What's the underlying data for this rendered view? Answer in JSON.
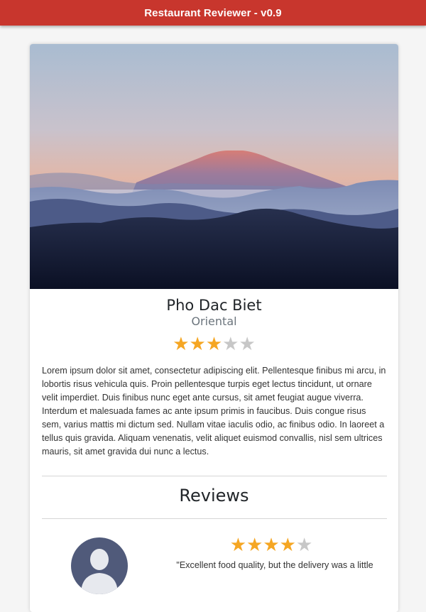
{
  "header": {
    "title": "Restaurant Reviewer - v0.9",
    "background_color": "#c8362d"
  },
  "restaurant": {
    "image": "mountain-sunset-photo",
    "name": "Pho Dac Biet",
    "cuisine": "Oriental",
    "rating": 3,
    "rating_max": 5,
    "description": "Lorem ipsum dolor sit amet, consectetur adipiscing elit. Pellentesque finibus mi arcu, in lobortis risus vehicula quis. Proin pellentesque turpis eget lectus tincidunt, ut ornare velit imperdiet. Duis finibus nunc eget ante cursus, sit amet feugiat augue viverra. Interdum et malesuada fames ac ante ipsum primis in faucibus. Duis congue risus sem, varius mattis mi dictum sed. Nullam vitae iaculis odio, ac finibus odio. In laoreet a tellus quis gravida. Aliquam venenatis, velit aliquet euismod convallis, nisl sem ultrices mauris, sit amet gravida dui nunc a lectus."
  },
  "reviews": {
    "heading": "Reviews",
    "items": [
      {
        "avatar": "user-avatar-icon",
        "rating": 4,
        "rating_max": 5,
        "text": "\"Excellent food quality, but the delivery was a little"
      }
    ]
  },
  "colors": {
    "star_filled": "#f5a623",
    "star_empty": "#c7c7c7",
    "avatar_bg": "#505a7a"
  }
}
